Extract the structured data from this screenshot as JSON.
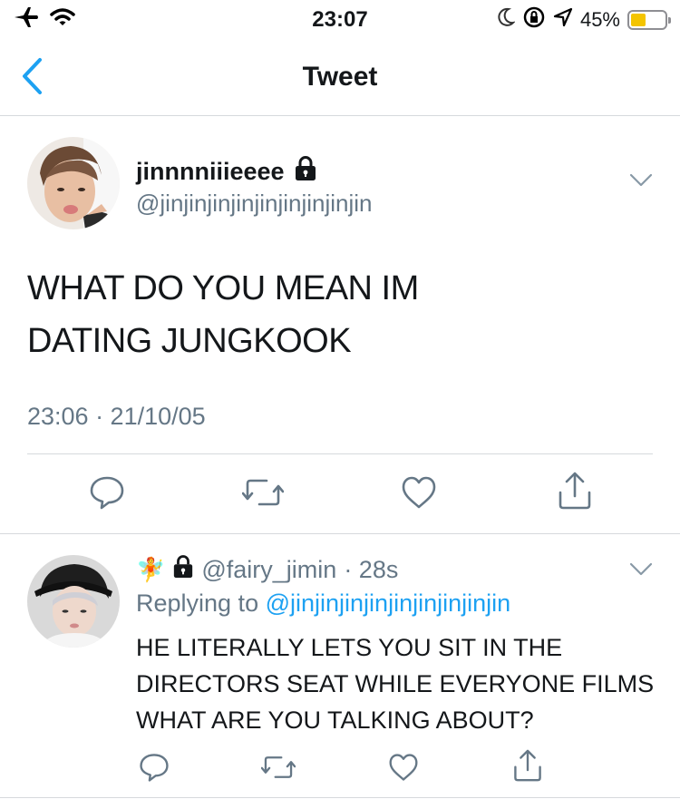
{
  "status_bar": {
    "time": "23:07",
    "battery_percent": "45%",
    "battery_level": 0.45,
    "battery_color": "#f4c400",
    "icons": [
      "airplane-icon",
      "wifi-icon",
      "moon-icon",
      "orientation-lock-icon",
      "location-icon",
      "battery-icon"
    ]
  },
  "nav": {
    "title": "Tweet",
    "back_icon": "chevron-left-icon",
    "accent": "#1da1f2"
  },
  "main_tweet": {
    "display_name": "jinnnniiieeee",
    "handle": "@jinjinjinjinjinjinjinjinjin",
    "text_line1": "WHAT DO YOU MEAN IM",
    "text_line2": "DATING JUNGKOOK",
    "timestamp": "23:06 · 21/10/05",
    "protected_icon": "lock-icon",
    "actions": [
      "reply-icon",
      "retweet-icon",
      "like-icon",
      "share-icon"
    ]
  },
  "reply": {
    "emoji": "🧚",
    "handle": "@fairy_jimin",
    "time": "· 28s",
    "replying_prefix": "Replying to",
    "replying_to": "@jinjinjinjinjinjinjinjinjin",
    "text": "HE LITERALLY LETS YOU SIT IN THE DIRECTORS SEAT WHILE EVERYONE FILMS WHAT ARE YOU TALKING ABOUT?",
    "actions": [
      "reply-icon",
      "retweet-icon",
      "like-icon",
      "share-icon"
    ]
  },
  "colors": {
    "text": "#14171a",
    "secondary": "#657786",
    "link": "#1da1f2",
    "divider": "#d6d9dc"
  }
}
